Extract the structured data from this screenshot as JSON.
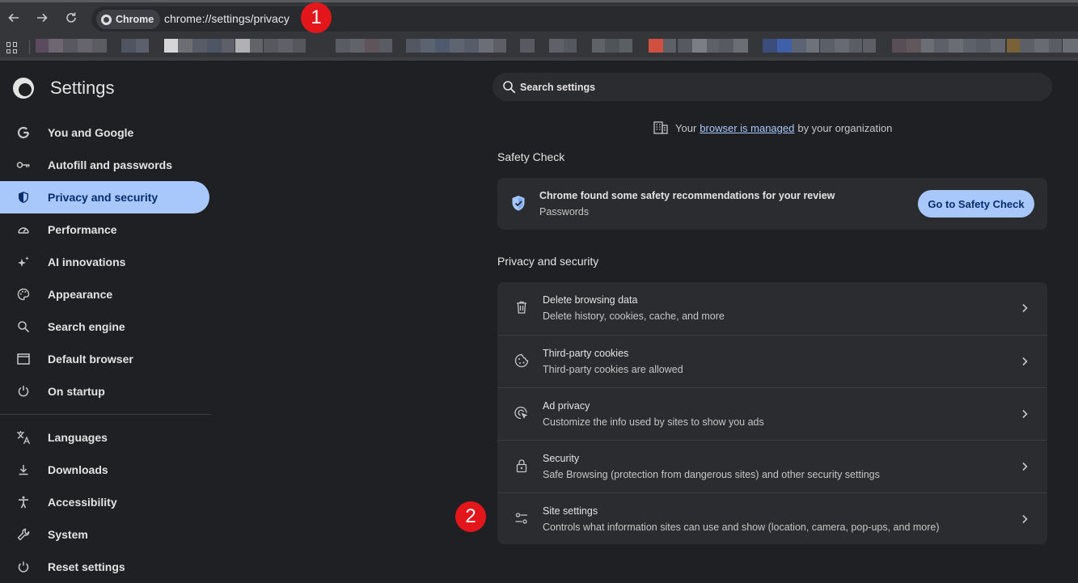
{
  "browser": {
    "chip_label": "Chrome",
    "url": "chrome://settings/privacy",
    "annotation_1": "1",
    "annotation_2": "2"
  },
  "sidebar": {
    "title": "Settings",
    "items": [
      {
        "label": "You and Google",
        "icon": "google-g-icon"
      },
      {
        "label": "Autofill and passwords",
        "icon": "key-icon"
      },
      {
        "label": "Privacy and security",
        "icon": "shield-icon",
        "active": true
      },
      {
        "label": "Performance",
        "icon": "speedometer-icon"
      },
      {
        "label": "AI innovations",
        "icon": "sparkle-icon"
      },
      {
        "label": "Appearance",
        "icon": "palette-icon"
      },
      {
        "label": "Search engine",
        "icon": "search-icon"
      },
      {
        "label": "Default browser",
        "icon": "browser-window-icon"
      },
      {
        "label": "On startup",
        "icon": "power-icon"
      },
      {
        "label": "Languages",
        "icon": "translate-icon"
      },
      {
        "label": "Downloads",
        "icon": "download-icon"
      },
      {
        "label": "Accessibility",
        "icon": "accessibility-icon"
      },
      {
        "label": "System",
        "icon": "wrench-icon"
      },
      {
        "label": "Reset settings",
        "icon": "reset-icon"
      }
    ]
  },
  "search": {
    "placeholder": "Search settings"
  },
  "managed": {
    "prefix": "Your",
    "link": "browser is managed",
    "suffix": "by your organization"
  },
  "safety_check": {
    "heading": "Safety Check",
    "title": "Chrome found some safety recommendations for your review",
    "subtitle": "Passwords",
    "button": "Go to Safety Check"
  },
  "privacy": {
    "heading": "Privacy and security",
    "rows": [
      {
        "title": "Delete browsing data",
        "subtitle": "Delete history, cookies, cache, and more",
        "icon": "trash-icon"
      },
      {
        "title": "Third-party cookies",
        "subtitle": "Third-party cookies are allowed",
        "icon": "cookie-icon"
      },
      {
        "title": "Ad privacy",
        "subtitle": "Customize the info used by sites to show you ads",
        "icon": "ad-privacy-icon"
      },
      {
        "title": "Security",
        "subtitle": "Safe Browsing (protection from dangerous sites) and other security settings",
        "icon": "lock-icon"
      },
      {
        "title": "Site settings",
        "subtitle": "Controls what information sites can use and show (location, camera, pop-ups, and more)",
        "icon": "tune-icon"
      }
    ]
  },
  "colors": {
    "accent": "#a8c7fa",
    "annotation": "#e3171b",
    "background": "#1f2023",
    "card": "#2b2c30"
  }
}
